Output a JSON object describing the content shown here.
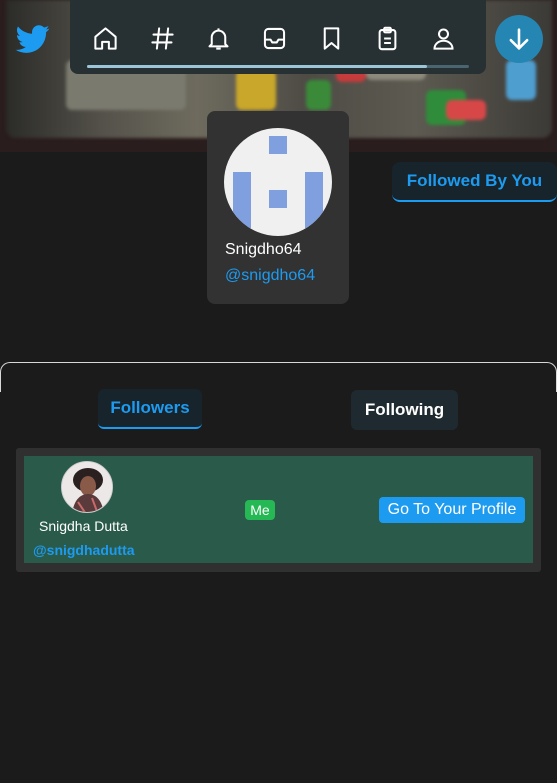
{
  "nav": {
    "icons": [
      "home-icon",
      "hashtag-icon",
      "bell-icon",
      "inbox-icon",
      "bookmark-icon",
      "clipboard-icon",
      "user-icon"
    ],
    "progress_fraction": 0.89,
    "scroll_button_icon": "arrow-down-icon",
    "brand_color": "#1d9bf0"
  },
  "profile": {
    "name": "Snigdho64",
    "handle": "@snigdho64",
    "followed_badge": "Followed By You"
  },
  "tabs": {
    "followers": "Followers",
    "following": "Following",
    "active": "Followers"
  },
  "followers": [
    {
      "name": "Snigdha Dutta",
      "handle": "@snigdhadutta",
      "badge": "Me",
      "action": "Go To Your Profile"
    }
  ],
  "colors": {
    "accent": "#1d9bf0",
    "row_background": "#2a5a4a",
    "me_badge": "#25b855"
  }
}
